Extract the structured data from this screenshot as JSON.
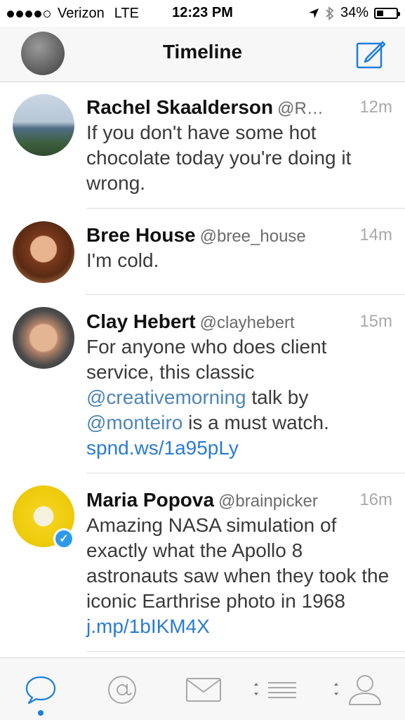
{
  "status_bar": {
    "carrier": "Verizon",
    "network": "LTE",
    "time": "12:23 PM",
    "battery_text": "34%",
    "battery_level": 0.34,
    "signal_bars": 4,
    "signal_total": 5
  },
  "header": {
    "title": "Timeline",
    "compose_icon": "compose-icon",
    "accent_color": "#1a7ee0"
  },
  "tweets": [
    {
      "name": "Rachel Skaalderson",
      "handle": "@R…",
      "time": "12m",
      "segments": [
        {
          "text": "If you don't have some hot chocolate today you're doing it wrong.",
          "type": "text"
        }
      ]
    },
    {
      "name": "Bree House",
      "handle": "@bree_house",
      "time": "14m",
      "segments": [
        {
          "text": "I'm cold.",
          "type": "text"
        }
      ]
    },
    {
      "name": "Clay Hebert",
      "handle": "@clayhebert",
      "time": "15m",
      "segments": [
        {
          "text": "For anyone who does client service, this classic ",
          "type": "text"
        },
        {
          "text": "@creativemorning",
          "type": "mention"
        },
        {
          "text": " talk by ",
          "type": "text"
        },
        {
          "text": "@monteiro",
          "type": "mention"
        },
        {
          "text": " is a must watch. ",
          "type": "text"
        },
        {
          "text": "spnd.ws/1a95pLy",
          "type": "link"
        }
      ]
    },
    {
      "name": "Maria Popova",
      "handle": "@brainpicker",
      "time": "16m",
      "segments": [
        {
          "text": "Amazing NASA simulation of exactly what the Apollo 8 astronauts saw when they took the iconic Earthrise photo in 1968 ",
          "type": "text"
        },
        {
          "text": "j.mp/1bIKM4X",
          "type": "link"
        }
      ]
    }
  ],
  "tabbar": {
    "tabs": [
      {
        "icon": "speech-bubble-icon",
        "active": true
      },
      {
        "icon": "at-sign-icon",
        "active": false
      },
      {
        "icon": "envelope-icon",
        "active": false
      },
      {
        "icon": "list-icon",
        "active": false
      },
      {
        "icon": "profile-icon",
        "active": false
      }
    ]
  }
}
